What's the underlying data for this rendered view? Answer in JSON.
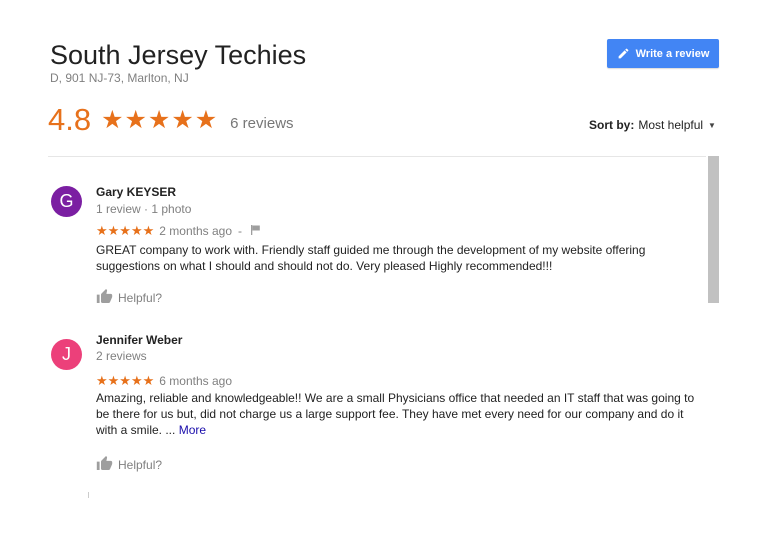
{
  "business": {
    "name": "South Jersey Techies",
    "address": "D, 901 NJ-73, Marlton, NJ",
    "rating": "4.8",
    "stars": "★★★★★",
    "review_count": "6 reviews",
    "rating_value": 4.8
  },
  "write_review": {
    "label": "Write a review",
    "icon": "pencil-icon",
    "color": "#4285f4"
  },
  "sort": {
    "label": "Sort by:",
    "value": "Most helpful",
    "icon": "caret-down-icon"
  },
  "colors": {
    "accent": "#e7711b",
    "link": "#1a0dab"
  },
  "reviews": [
    {
      "initial": "G",
      "avatar_color": "#7b1fa2",
      "name": "Gary KEYSER",
      "meta": "1 review · 1 photo",
      "stars": "★★★★★",
      "time": "2 months ago",
      "separator": "-",
      "flag_icon": "flag-icon",
      "text": "GREAT company to work with. Friendly staff guided me through the development of my website offering suggestions on what I should and should not do. Very pleased Highly recommended!!!",
      "helpful": "Helpful?"
    },
    {
      "initial": "J",
      "avatar_color": "#ec407a",
      "name": "Jennifer Weber",
      "meta": "2 reviews",
      "stars": "★★★★★",
      "time": "6 months ago",
      "text": "Amazing, reliable and knowledgeable!! We are a small Physicians office that needed an IT staff that was going to be there for us but, did not charge us a large support fee. They have met every need for our company and do it with a smile. ...",
      "more": "More",
      "helpful": "Helpful?"
    }
  ]
}
